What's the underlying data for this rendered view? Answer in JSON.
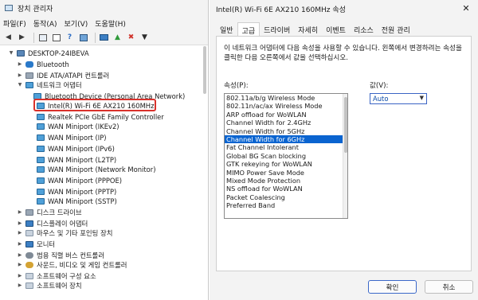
{
  "device_manager": {
    "title": "장치 관리자",
    "menu": [
      "파일(F)",
      "동작(A)",
      "보기(V)",
      "도움말(H)"
    ],
    "toolbar_icons": [
      "back-arrow-icon",
      "forward-arrow-icon",
      "view-icon",
      "properties-icon",
      "help-icon",
      "scan-icon",
      "monitor-icon",
      "add-driver-icon",
      "disable-icon",
      "uninstall-icon",
      "download-icon"
    ],
    "tree": [
      {
        "label": "DESKTOP-24IBEVA",
        "icon": "computer-icon"
      },
      {
        "label": "Bluetooth",
        "icon": "bluetooth-icon"
      },
      {
        "label": "IDE ATA/ATAPI 컨트롤러",
        "icon": "ide-controller-icon"
      },
      {
        "label": "네트워크 어댑터",
        "icon": "network-adapter-icon"
      },
      {
        "label": "Bluetooth Device (Personal Area Network)",
        "icon": "network-adapter-icon"
      },
      {
        "label": "Intel(R) Wi-Fi 6E AX210 160MHz",
        "icon": "network-adapter-icon"
      },
      {
        "label": "Realtek PCIe GbE Family Controller",
        "icon": "network-adapter-icon"
      },
      {
        "label": "WAN Miniport (IKEv2)",
        "icon": "network-adapter-icon"
      },
      {
        "label": "WAN Miniport (IP)",
        "icon": "network-adapter-icon"
      },
      {
        "label": "WAN Miniport (IPv6)",
        "icon": "network-adapter-icon"
      },
      {
        "label": "WAN Miniport (L2TP)",
        "icon": "network-adapter-icon"
      },
      {
        "label": "WAN Miniport (Network Monitor)",
        "icon": "network-adapter-icon"
      },
      {
        "label": "WAN Miniport (PPPOE)",
        "icon": "network-adapter-icon"
      },
      {
        "label": "WAN Miniport (PPTP)",
        "icon": "network-adapter-icon"
      },
      {
        "label": "WAN Miniport (SSTP)",
        "icon": "network-adapter-icon"
      },
      {
        "label": "디스크 드라이브",
        "icon": "disk-drive-icon"
      },
      {
        "label": "디스플레이 어댑터",
        "icon": "display-adapter-icon"
      },
      {
        "label": "마우스 및 기타 포인팅 장치",
        "icon": "mouse-icon"
      },
      {
        "label": "모니터",
        "icon": "monitor-icon"
      },
      {
        "label": "범용 직렬 버스 컨트롤러",
        "icon": "usb-icon"
      },
      {
        "label": "사운드, 비디오 및 게임 컨트롤러",
        "icon": "sound-icon"
      },
      {
        "label": "소프트웨어 구성 요소",
        "icon": "software-component-icon"
      },
      {
        "label": "소프트웨어 장치",
        "icon": "software-device-icon"
      }
    ]
  },
  "properties": {
    "title": "Intel(R) Wi-Fi 6E AX210 160MHz 속성",
    "tabs": [
      "일반",
      "고급",
      "드라이버",
      "자세히",
      "이벤트",
      "리소스",
      "전원 관리"
    ],
    "description": "이 네트워크 어댑터에 다음 속성을 사용할 수 있습니다. 왼쪽에서 변경하려는 속성을 클릭한 다음 오른쪽에서 값을 선택하십시오.",
    "property_label": "속성(P):",
    "value_label": "값(V):",
    "property_list": [
      "802.11a/b/g Wireless Mode",
      "802.11n/ac/ax Wireless Mode",
      "ARP offload for WoWLAN",
      "Channel Width for 2.4GHz",
      "Channel Width for 5GHz",
      "Channel Width for 6GHz",
      "Fat Channel Intolerant",
      "Global BG Scan blocking",
      "GTK rekeying for WoWLAN",
      "MIMO Power Save Mode",
      "Mixed Mode Protection",
      "NS offload for WoWLAN",
      "Packet Coalescing",
      "Preferred Band"
    ],
    "selected_value": "Auto",
    "ok_label": "확인",
    "cancel_label": "취소"
  },
  "colors": {
    "selection": "#0a64d0",
    "highlight_box": "#d9312b"
  }
}
